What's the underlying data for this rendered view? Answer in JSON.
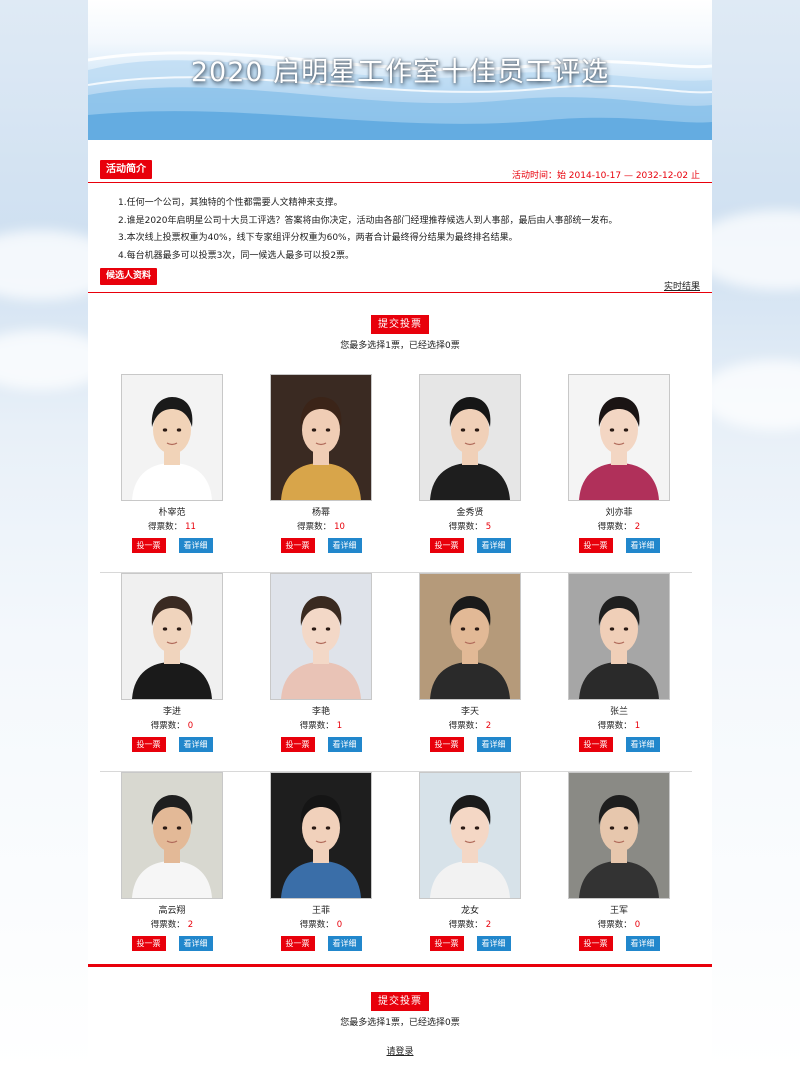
{
  "banner": {
    "title": "2020 启明星工作室十佳员工评选"
  },
  "intro": {
    "tag": "活动简介",
    "period": "活动时间：始  2014-10-17  —  2032-12-02 止",
    "rules": [
      "1.任何一个公司，其独特的个性都需要人文精神来支撑。",
      "2.谁是2020年启明星公司十大员工评选？答案将由你决定，活动由各部门经理推荐候选人到人事部，最后由人事部统一发布。",
      "3.本次线上投票权重为40%，线下专家组评分权重为60%，两者合计最终得分结果为最终排名结果。",
      "4.每台机器最多可以投票3次，同一候选人最多可以投2票。"
    ]
  },
  "candidates_section": {
    "tag": "候选人资料",
    "realtime_link": "实时结果"
  },
  "submit": {
    "label": "提交投票",
    "hint": "您最多选择1票，已经选择0票"
  },
  "labels": {
    "votes": "得票数：",
    "vote_btn": "投一票",
    "detail_btn": "看详细"
  },
  "candidates": [
    {
      "name": "朴宰范",
      "votes": "11"
    },
    {
      "name": "杨幂",
      "votes": "10"
    },
    {
      "name": "金秀贤",
      "votes": "5"
    },
    {
      "name": "刘亦菲",
      "votes": "2"
    },
    {
      "name": "李进",
      "votes": "0"
    },
    {
      "name": "李艳",
      "votes": "1"
    },
    {
      "name": "李天",
      "votes": "2"
    },
    {
      "name": "张兰",
      "votes": "1"
    },
    {
      "name": "高云翔",
      "votes": "2"
    },
    {
      "name": "王菲",
      "votes": "0"
    },
    {
      "name": "龙女",
      "votes": "2"
    },
    {
      "name": "王军",
      "votes": "0"
    }
  ],
  "footer": {
    "login_link": "请登录"
  },
  "colors": {
    "accent": "#e8000b",
    "detail": "#2187cc"
  }
}
